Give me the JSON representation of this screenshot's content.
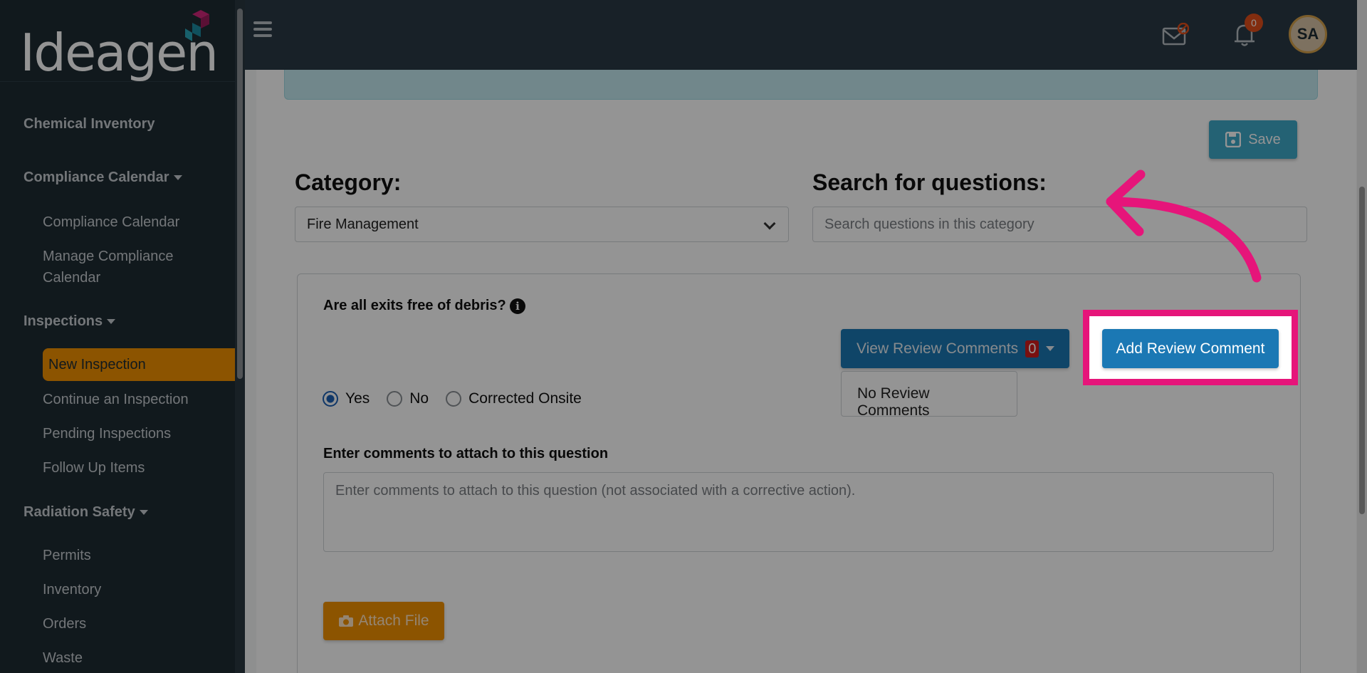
{
  "brand": {
    "logo_text": "Ideagen"
  },
  "sidebar": {
    "sections": [
      {
        "label": "Chemical Inventory"
      },
      {
        "label": "Compliance Calendar"
      },
      {
        "label": "Inspections"
      },
      {
        "label": "Radiation Safety"
      }
    ],
    "items": [
      {
        "label": "Compliance Calendar"
      },
      {
        "label": "Manage Compliance Calendar"
      },
      {
        "label": "New Inspection"
      },
      {
        "label": "Continue an Inspection"
      },
      {
        "label": "Pending Inspections"
      },
      {
        "label": "Follow Up Items"
      },
      {
        "label": "Permits"
      },
      {
        "label": "Inventory"
      },
      {
        "label": "Orders"
      },
      {
        "label": "Waste"
      }
    ]
  },
  "topbar": {
    "notification_count": "0",
    "avatar_initials": "SA"
  },
  "toolbar": {
    "save_label": "Save"
  },
  "form": {
    "category_label": "Category:",
    "category_value": "Fire Management",
    "search_label": "Search for questions:",
    "search_placeholder": "Search questions in this category"
  },
  "question": {
    "title": "Are all exits free of debris?",
    "info_glyph": "i",
    "view_comments_label": "View Review Comments",
    "view_comments_count": "0",
    "no_comments_text": "No Review Comments",
    "add_comment_label": "Add Review Comment",
    "options": [
      {
        "label": "Yes",
        "checked": true
      },
      {
        "label": "No",
        "checked": false
      },
      {
        "label": "Corrected Onsite",
        "checked": false
      }
    ],
    "comments_label": "Enter comments to attach to this question",
    "comments_placeholder": "Enter comments to attach to this question (not associated with a corrective action).",
    "attach_label": "Attach File"
  },
  "colors": {
    "accent_highlight": "#e6157a",
    "primary_button": "#1b78b4",
    "active_nav": "#f29100"
  }
}
